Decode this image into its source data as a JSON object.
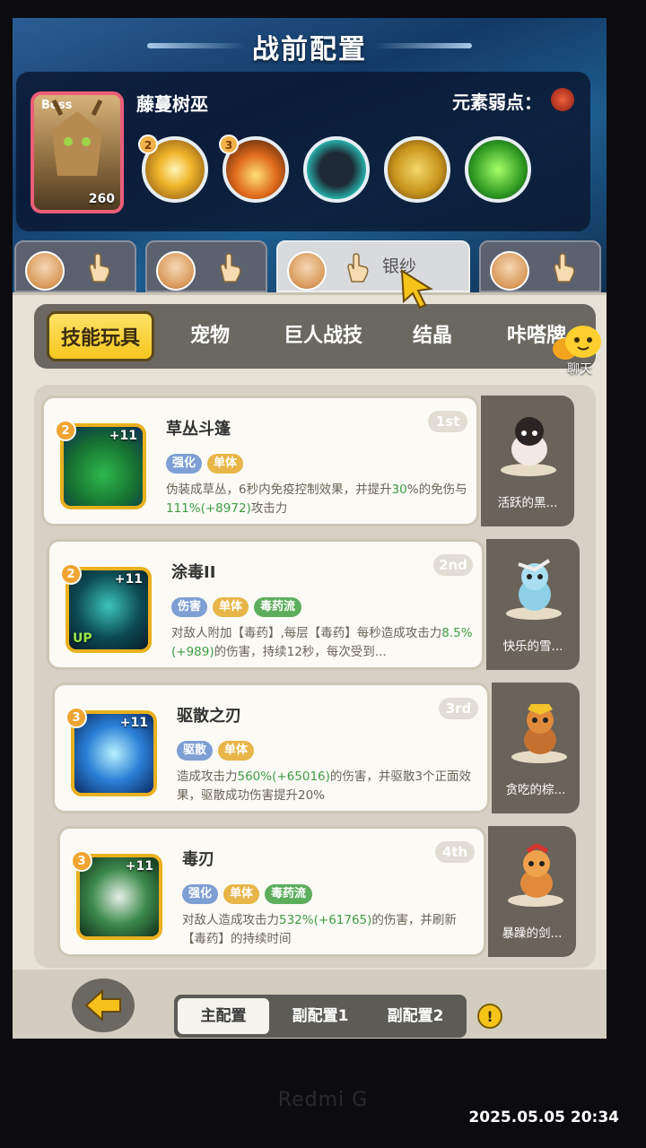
{
  "header": {
    "title": "战前配置"
  },
  "boss": {
    "tag": "Boss",
    "level": "260",
    "name": "藤蔓树巫",
    "weakness_label": "元素弱点：",
    "skills": [
      {
        "level": "2",
        "icon": "burst-icon"
      },
      {
        "level": "3",
        "icon": "fire-icon"
      },
      {
        "level": "",
        "icon": "shadow-creature-icon"
      },
      {
        "level": "",
        "icon": "claw-strike-icon"
      },
      {
        "level": "",
        "icon": "poison-cloud-icon"
      }
    ]
  },
  "character_tabs": [
    {
      "name": ""
    },
    {
      "name": ""
    },
    {
      "name": "银纱"
    },
    {
      "name": ""
    }
  ],
  "categories": [
    "技能玩具",
    "宠物",
    "巨人战技",
    "结晶",
    "咔嗒牌"
  ],
  "chat": {
    "label": "聊天"
  },
  "skills": [
    {
      "title": "草丛斗篷",
      "rank": "1st",
      "level": "2",
      "plus": "+11",
      "up": "",
      "tags": [
        {
          "text": "强化",
          "color": "blue"
        },
        {
          "text": "单体",
          "color": "orange"
        }
      ],
      "desc_a": "伪装成草丛，6秒内免疫控制效果，并提升",
      "desc_b": "30",
      "desc_c": "%的免伤与",
      "desc_d": "111",
      "desc_e": "%(+8972)",
      "desc_f": "攻击力",
      "pet": "活跃的黑..."
    },
    {
      "title": "涂毒II",
      "rank": "2nd",
      "level": "2",
      "plus": "+11",
      "up": "UP",
      "tags": [
        {
          "text": "伤害",
          "color": "blue"
        },
        {
          "text": "单体",
          "color": "orange"
        },
        {
          "text": "毒药流",
          "color": "green"
        }
      ],
      "desc_a": "对敌人附加【毒药】,每层【毒药】每秒造成攻击力",
      "desc_b": "8.5",
      "desc_c": "%",
      "desc_d": "(+989)",
      "desc_e": "",
      "desc_f": "的伤害，持续12秒，每次受到...",
      "pet": "快乐的雪..."
    },
    {
      "title": "驱散之刃",
      "rank": "3rd",
      "level": "3",
      "plus": "+11",
      "up": "",
      "tags": [
        {
          "text": "驱散",
          "color": "blue"
        },
        {
          "text": "单体",
          "color": "orange"
        }
      ],
      "desc_a": "造成攻击力",
      "desc_b": "560",
      "desc_c": "%",
      "desc_d": "(+65016)",
      "desc_e": "",
      "desc_f": "的伤害，并驱散3个正面效果，驱散成功伤害提升20%",
      "pet": "贪吃的棕..."
    },
    {
      "title": "毒刃",
      "rank": "4th",
      "level": "3",
      "plus": "+11",
      "up": "",
      "tags": [
        {
          "text": "强化",
          "color": "blue"
        },
        {
          "text": "单体",
          "color": "orange"
        },
        {
          "text": "毒药流",
          "color": "green"
        }
      ],
      "desc_a": "对敌人造成攻击力",
      "desc_b": "532",
      "desc_c": "%",
      "desc_d": "(+61765)",
      "desc_e": "",
      "desc_f": "的伤害，并刷新【毒药】的持续时间",
      "pet": "暴躁的剑..."
    }
  ],
  "config_tabs": [
    "主配置",
    "副配置1",
    "副配置2"
  ],
  "info_button": "!",
  "device": {
    "brand": "Redmi G",
    "timestamp": "2025.05.05  20:34"
  },
  "colors": {
    "accent_yellow": "#f5c61e",
    "boss_border": "#ea5e78",
    "value_green": "#3e9d44"
  }
}
